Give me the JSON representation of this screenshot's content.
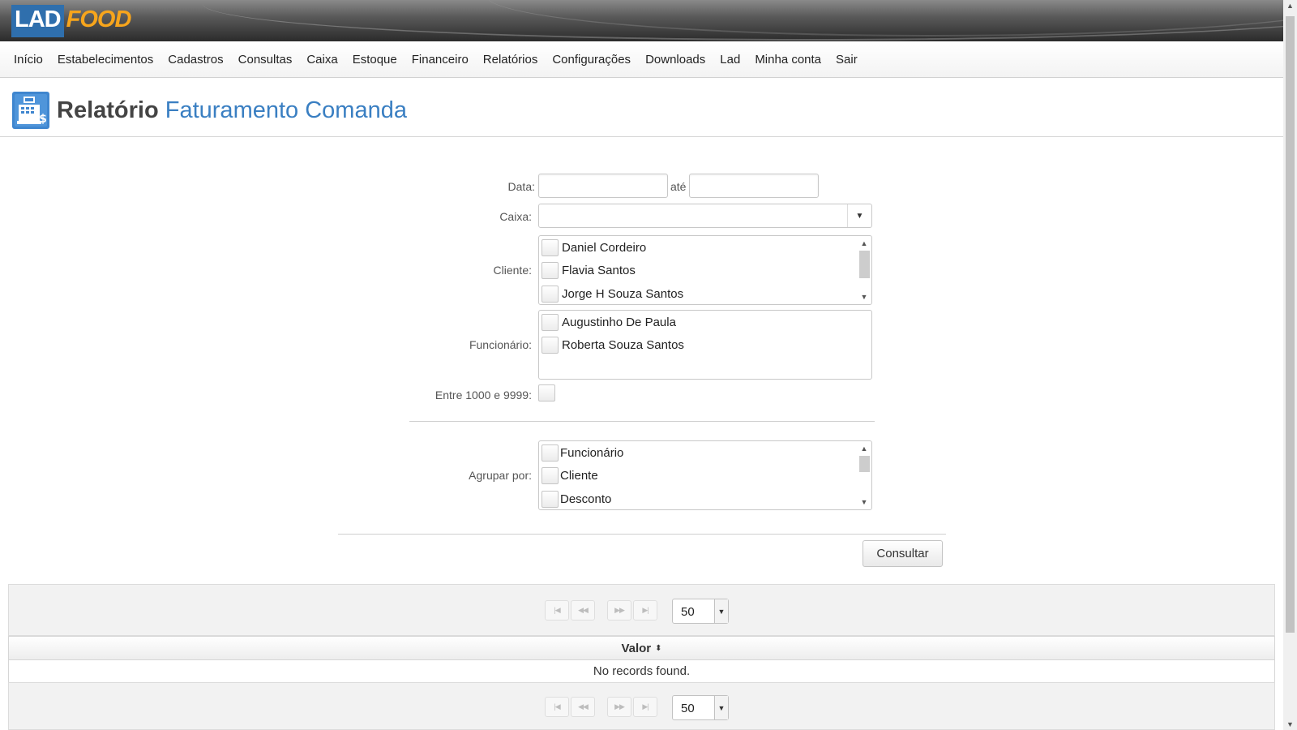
{
  "logo": {
    "part1": "LAD",
    "part2": "FOOD"
  },
  "menu": [
    "Início",
    "Estabelecimentos",
    "Cadastros",
    "Consultas",
    "Caixa",
    "Estoque",
    "Financeiro",
    "Relatórios",
    "Configurações",
    "Downloads",
    "Lad",
    "Minha conta",
    "Sair"
  ],
  "title": {
    "prefix": "Relatório",
    "name": "Faturamento Comanda"
  },
  "form": {
    "data_label": "Data:",
    "ate_label": "até",
    "data_from": "",
    "data_to": "",
    "caixa_label": "Caixa:",
    "caixa_value": "",
    "cliente_label": "Cliente:",
    "clientes": [
      "Daniel Cordeiro",
      "Flavia Santos",
      "Jorge H Souza Santos"
    ],
    "funcionario_label": "Funcionário:",
    "funcionarios": [
      "Augustinho De Paula",
      "Roberta Souza Santos"
    ],
    "entre_label": "Entre 1000 e 9999:",
    "agrupar_label": "Agrupar por:",
    "agrupar": [
      "Funcionário",
      "Cliente",
      "Desconto"
    ],
    "consultar_label": "Consultar"
  },
  "table": {
    "rows_per_page": "50",
    "column": "Valor",
    "empty": "No records found."
  },
  "icons": {
    "first": "first-page-icon",
    "prev": "prev-page-icon",
    "next": "next-page-icon",
    "last": "last-page-icon",
    "report": "cash-register-icon"
  },
  "colors": {
    "accent": "#3a7fc2",
    "logo_blue": "#2f6fad",
    "logo_orange": "#f7a51c"
  }
}
